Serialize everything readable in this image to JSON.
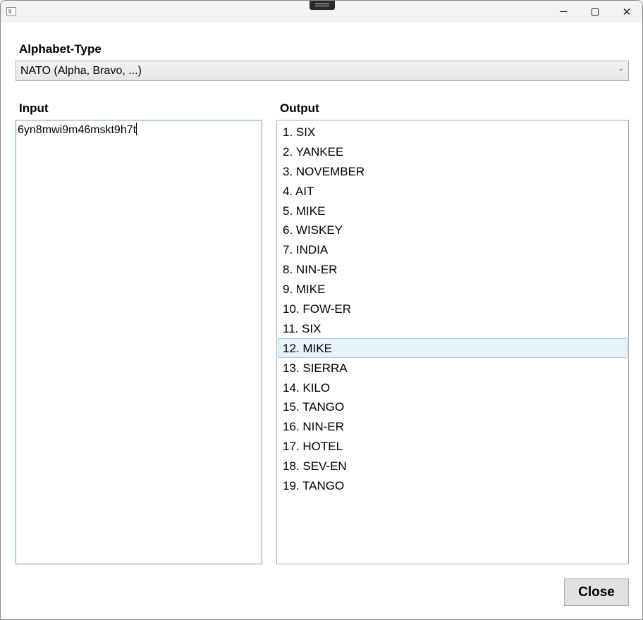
{
  "titlebar": {
    "icons": {
      "app": "app-window-icon",
      "minimize": "minimize-icon",
      "maximize": "maximize-icon",
      "close": "close-icon"
    },
    "close_glyph": "✕"
  },
  "alphabet": {
    "label": "Alphabet-Type",
    "selected": "NATO (Alpha, Bravo, ...)",
    "arrow": "⌄"
  },
  "input": {
    "label": "Input",
    "value": "6yn8mwi9m46mskt9h7t"
  },
  "output": {
    "label": "Output",
    "selected_index": 11,
    "items": [
      "1. SIX",
      "2. YANKEE",
      "3. NOVEMBER",
      "4. AIT",
      "5. MIKE",
      "6. WISKEY",
      "7. INDIA",
      "8. NIN-ER",
      "9. MIKE",
      "10. FOW-ER",
      "11. SIX",
      "12. MIKE",
      "13. SIERRA",
      "14. KILO",
      "15. TANGO",
      "16. NIN-ER",
      "17. HOTEL",
      "18. SEV-EN",
      "19. TANGO"
    ]
  },
  "footer": {
    "close_label": "Close"
  },
  "colors": {
    "selection_bg": "#e5f3fb",
    "selection_border": "#a6cee9",
    "input_border": "#6e9fbf"
  }
}
